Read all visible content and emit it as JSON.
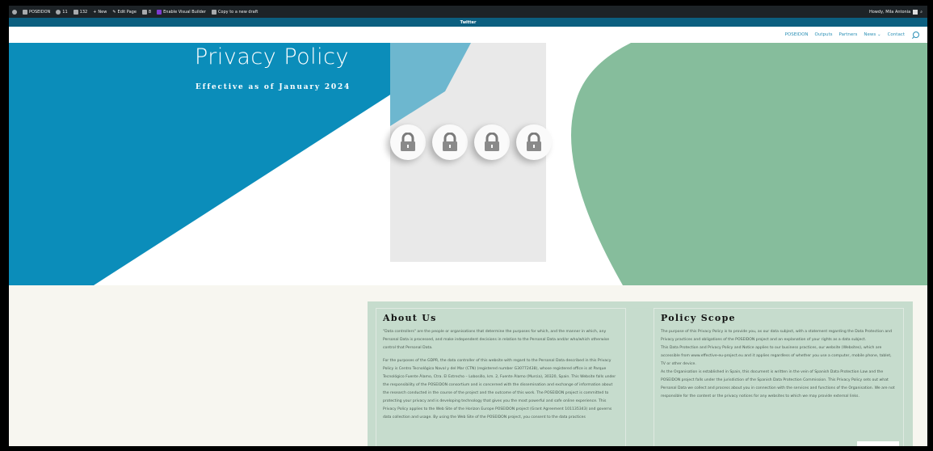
{
  "admin_bar": {
    "site_name": "POSEIDON",
    "updates_count": "11",
    "comments_count": "132",
    "new_label": "New",
    "edit_label": "Edit Page",
    "wpforms_label": "8",
    "visual_builder_label": "Enable Visual Builder",
    "copy_label": "Copy to a new draft",
    "greeting": "Howdy, Mila Antonia"
  },
  "top_bar": {
    "link": "Twitter"
  },
  "nav": {
    "items": [
      "POSEIDON",
      "Outputs",
      "Partners",
      "News",
      "Contact"
    ],
    "news_caret": "⌄"
  },
  "hero": {
    "title": "Privacy Policy",
    "subtitle": "Effective as of January 2024",
    "colors": {
      "blue": "#0b8dba",
      "light_blue": "#6db7cf",
      "green": "#86bd9c",
      "gray_panel": "#e9e9e9"
    }
  },
  "about": {
    "heading": "About Us",
    "paragraphs": [
      "\"Data controllers\" are the people or organisations that determine the purposes for which, and the manner in which, any Personal Data is processed, and make independent decisions in relation to the Personal Data and/or who/which otherwise control that Personal Data.",
      "For the purposes of the GDPR, the data controller of this website with regard to the Personal Data described in this Privacy Policy is Centro Tecnológico Naval y del Mar (CTN) (registered number G30772438), whose registered office is at Parque Tecnológico Fuente Álamo, Ctra. El Estrecho – Lobosillo, km. 2, Fuente Álamo (Murcia), 30320, Spain. This Website falls under the responsibility of the POSEIDON consortium and is concerned with the dissemination and exchange of information about the research conducted in the course of the project and the outcome of this work. The POSEIDON project is committed to protecting your privacy and is developing technology that gives you the most powerful and safe online experience. This Privacy Policy applies to the Web Site of the Horizon Europe POSEIDON project (Grant Agreement 101135343) and governs data collection and usage. By using the Web Site of the POSEIDON project, you consent to the data practices"
    ]
  },
  "scope": {
    "heading": "Policy Scope",
    "paragraphs": [
      "The purpose of this Privacy Policy is to provide you, as our data subject, with a statement regarding the Data Protection and Privacy practices and obligations of the POSEIDON project and an explanation of your rights as a data subject.",
      "This Data Protection and Privacy Policy and Notice applies to our business practices, our website (Websites), which are accessible from www.effective-eu-project.eu and it applies regardless of whether you use a computer, mobile phone, tablet, TV or other device.",
      "As the Organisation is established in Spain, this document is written in the vein of Spanish Data Protection Law and the POSEIDON project falls under the jurisdiction of the Spanish Data Protection Commission. This Privacy Policy sets out what Personal Data we collect and process about you in connection with the services and functions of the Organisation. We are not responsible for the content or the privacy notices for any websites to which we may provide external links."
    ]
  }
}
